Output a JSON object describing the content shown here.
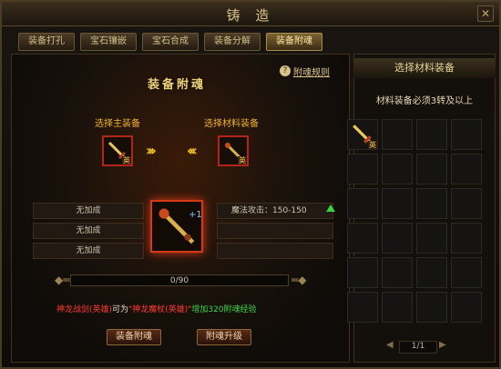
{
  "window": {
    "title": "铸  造"
  },
  "tabs": [
    {
      "label": "装备打孔"
    },
    {
      "label": "宝石镶嵌"
    },
    {
      "label": "宝石合成"
    },
    {
      "label": "装备分解"
    },
    {
      "label": "装备附魂",
      "active": true
    }
  ],
  "main": {
    "title": "装备附魂",
    "help_link": "附魂规则",
    "main_slot_label": "选择主装备",
    "material_slot_label": "选择材料装备",
    "main_item_badge": "英",
    "material_item_badge": "英",
    "center_item_plus": "+1",
    "left_stats": [
      "无加成",
      "无加成",
      "无加成"
    ],
    "right_stat": "魔法攻击：150-150",
    "progress": {
      "text": "0/90",
      "fraction": 0
    },
    "message": {
      "part1": "神龙战剑(英雄)",
      "part2": "可为",
      "part3": "\"神龙魔杖(英雄)\"",
      "part4": "增加320附魂经验"
    },
    "buttons": {
      "enchant": "装备附魂",
      "upgrade": "附魂升级"
    }
  },
  "side": {
    "title": "选择材料装备",
    "note": "材料装备必须3转及以上",
    "first_item_badge": "英",
    "pager": "1/1"
  },
  "colors": {
    "accent": "#f0b330",
    "slot_border": "#b3241b",
    "positive": "#3dd64a",
    "warning": "#ff3b30"
  }
}
